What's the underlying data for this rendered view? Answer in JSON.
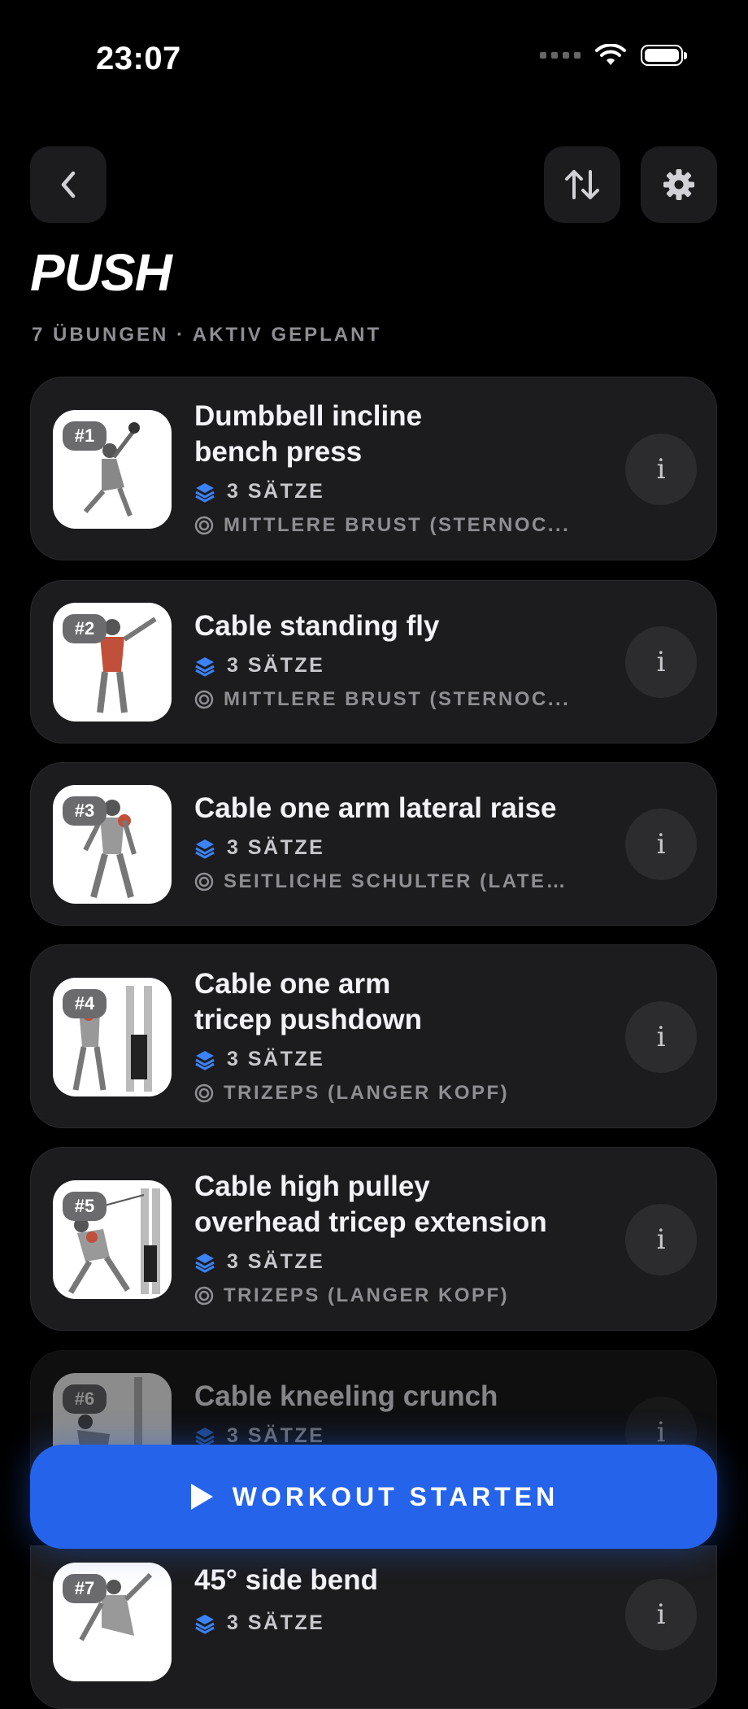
{
  "status_bar": {
    "time": "23:07"
  },
  "header": {
    "title": "PUSH",
    "subtitle": "7 ÜBUNGEN · AKTIV GEPLANT"
  },
  "exercises": [
    {
      "number": "#1",
      "name_line1": "Dumbbell incline",
      "name_line2": "bench press",
      "sets": "3 SÄTZE",
      "muscle": "MITTLERE BRUST (STERNOC..."
    },
    {
      "number": "#2",
      "name_line1": "Cable standing fly",
      "name_line2": "",
      "sets": "3 SÄTZE",
      "muscle": "MITTLERE BRUST (STERNOC..."
    },
    {
      "number": "#3",
      "name_line1": "Cable one arm lateral raise",
      "name_line2": "",
      "sets": "3 SÄTZE",
      "muscle": "SEITLICHE SCHULTER (LATER..."
    },
    {
      "number": "#4",
      "name_line1": "Cable one arm",
      "name_line2": "tricep pushdown",
      "sets": "3 SÄTZE",
      "muscle": "TRIZEPS (LANGER KOPF)"
    },
    {
      "number": "#5",
      "name_line1": "Cable high pulley",
      "name_line2": "overhead tricep extension",
      "sets": "3 SÄTZE",
      "muscle": "TRIZEPS (LANGER KOPF)"
    },
    {
      "number": "#6",
      "name_line1": "Cable kneeling crunch",
      "name_line2": "",
      "sets": "3 SÄTZE",
      "muscle": ""
    },
    {
      "number": "#7",
      "name_line1": "45° side bend",
      "name_line2": "",
      "sets": "3 SÄTZE",
      "muscle": ""
    }
  ],
  "info_label": "i",
  "start_button": {
    "label": "WORKOUT STARTEN"
  },
  "colors": {
    "accent": "#2563eb",
    "card": "#1c1c1e",
    "sets_icon": "#3b82f6"
  },
  "icons": [
    "back-chevron-icon",
    "sort-arrows-icon",
    "gear-icon",
    "layers-icon",
    "target-icon",
    "play-icon",
    "wifi-icon",
    "battery-icon"
  ]
}
